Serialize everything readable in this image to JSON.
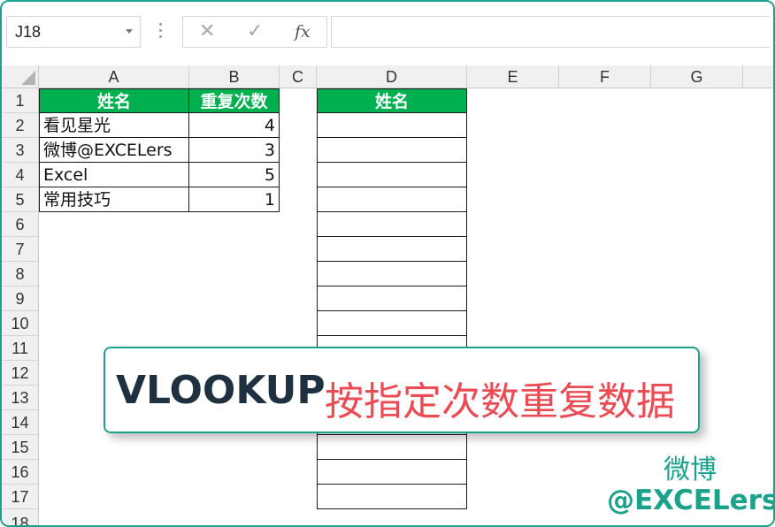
{
  "formula_bar": {
    "name_box": "J18",
    "cancel_icon": "✕",
    "enter_icon": "✓",
    "fx_label": "fx",
    "formula": ""
  },
  "columns": [
    "A",
    "B",
    "C",
    "D",
    "E",
    "F",
    "G"
  ],
  "rows": [
    "1",
    "2",
    "3",
    "4",
    "5",
    "6",
    "7",
    "8",
    "9",
    "10",
    "11",
    "12",
    "13",
    "14",
    "15",
    "16",
    "17",
    "18"
  ],
  "table1": {
    "header": [
      "姓名",
      "重复次数"
    ],
    "rows": [
      [
        "看见星光",
        "4"
      ],
      [
        "微博@EXCELers",
        "3"
      ],
      [
        "Excel",
        "5"
      ],
      [
        "常用技巧",
        "1"
      ]
    ]
  },
  "table2": {
    "header": "姓名"
  },
  "banner": {
    "part1": "VLOOKUP",
    "part2": "按指定次数重复数据"
  },
  "watermark": {
    "line1": "微博",
    "line2": "@EXCELers"
  },
  "colors": {
    "header_green": "#00b050",
    "accent_teal": "#1aa28b",
    "banner_red": "#ea4c56",
    "banner_dark": "#1f3140"
  }
}
